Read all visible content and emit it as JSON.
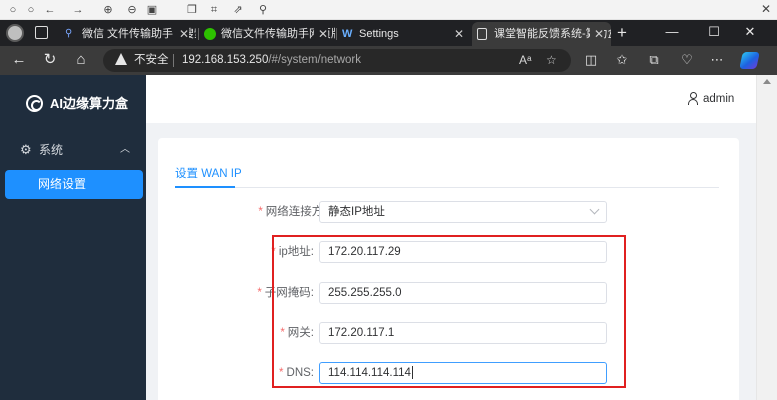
{
  "browser": {
    "mini_toolbar": {
      "icons": [
        "dot-icon",
        "dot-icon",
        "back-icon",
        "forward-icon",
        "zoom-in-icon",
        "zoom-out-icon",
        "fit-icon",
        "copy-icon",
        "screenshot-icon",
        "share-icon",
        "pin-icon"
      ],
      "close": "✕"
    },
    "tabs": [
      {
        "title": "微信 文件传输助手 - 搜索",
        "favicon": "search-icon",
        "active": false
      },
      {
        "title": "微信文件传输助手网页版",
        "favicon": "wechat-icon",
        "active": false
      },
      {
        "title": "Settings",
        "favicon": "settings-app-icon",
        "active": false
      },
      {
        "title": "课堂智能反馈系统-算力盒子",
        "favicon": "page-icon",
        "active": true
      }
    ],
    "tab_close": "✕",
    "new_tab": "+",
    "window_controls": {
      "minimize": "—",
      "maximize": "☐",
      "close": "✕"
    },
    "address": {
      "security": "不安全",
      "host": "192.168.153.250",
      "path": "/#/system/network"
    },
    "nav_icons": {
      "back": "←",
      "reload": "↻",
      "home": "⌂"
    }
  },
  "app": {
    "logo_text": "AI边缘算力盒",
    "user": "admin",
    "sidebar": {
      "group_label": "系统",
      "items": [
        {
          "label": "网络设置",
          "active": true
        }
      ]
    },
    "form": {
      "tab_label": "设置 WAN IP",
      "connection_type": {
        "label": "网络连接方式:",
        "value": "静态IP地址"
      },
      "ip": {
        "label": "ip地址:",
        "value": "172.20.117.29"
      },
      "subnet": {
        "label": "子网掩码:",
        "value": "255.255.255.0"
      },
      "gateway": {
        "label": "网关:",
        "value": "172.20.117.1"
      },
      "dns": {
        "label": "DNS:",
        "value": "114.114.114.114"
      },
      "required_mark": "*"
    }
  },
  "colors": {
    "sidebar_bg": "#1f2d3d",
    "accent": "#1e90ff",
    "highlight_box": "#e02020",
    "required": "#f56c6c"
  }
}
